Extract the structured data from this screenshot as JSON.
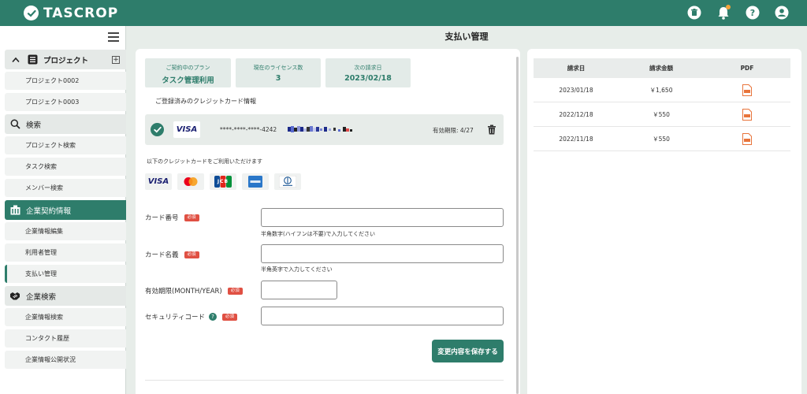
{
  "app": {
    "name": "TASCROP"
  },
  "header_icons": [
    "trash-icon",
    "bell-icon",
    "help-icon",
    "user-icon"
  ],
  "colors": {
    "brand": "#2e7d6b",
    "required": "#e05043",
    "pdf": "#e8743b",
    "notification": "#f2a33a"
  },
  "page": {
    "title": "支払い管理"
  },
  "sidebar": {
    "project": {
      "label": "プロジェクト",
      "items": [
        "プロジェクト0002",
        "プロジェクト0003"
      ]
    },
    "search": {
      "label": "検索",
      "items": [
        "プロジェクト検索",
        "タスク検索",
        "メンバー検索"
      ]
    },
    "company_contract": {
      "label": "企業契約情報",
      "items": [
        "企業情報編集",
        "利用者管理",
        "支払い管理"
      ],
      "selected": "支払い管理"
    },
    "company_search": {
      "label": "企業検索",
      "items": [
        "企業情報検索",
        "コンタクト履歴",
        "企業情報公開状況"
      ]
    }
  },
  "summary": [
    {
      "label": "ご契約中のプラン",
      "value": "タスク管理利用"
    },
    {
      "label": "現在のライセンス数",
      "value": "3"
    },
    {
      "label": "次の請求日",
      "value": "2023/02/18"
    }
  ],
  "registered_card": {
    "section_label": "ご登録済みのクレジットカード情報",
    "brand": "VISA",
    "masked_number": "****-****-****-4242",
    "expiry": "有効期限: 4/27"
  },
  "accepted_cards": {
    "label": "以下のクレジットカードをご利用いただけます",
    "brands": [
      "VISA",
      "Mastercard",
      "JCB",
      "American Express",
      "Diners Club"
    ],
    "visa_text": "VISA",
    "jcb_text": "JCB"
  },
  "form": {
    "required_badge": "必須",
    "card_number": {
      "label": "カード番号",
      "value": "",
      "hint": "半角数字(ハイフンは不要)で入力してください"
    },
    "card_name": {
      "label": "カード名義",
      "value": "",
      "hint": "半角英字で入力してください"
    },
    "expiry": {
      "label": "有効期限(MONTH/YEAR)",
      "value": ""
    },
    "security_code": {
      "label": "セキュリティコード",
      "help": "?",
      "value": ""
    },
    "save_label": "変更内容を保存する"
  },
  "billing": {
    "headers": {
      "date": "請求日",
      "amount": "請求金額",
      "pdf": "PDF"
    },
    "rows": [
      {
        "date": "2023/01/18",
        "amount": "￥1,650"
      },
      {
        "date": "2022/12/18",
        "amount": "￥550"
      },
      {
        "date": "2022/11/18",
        "amount": "￥550"
      }
    ]
  }
}
